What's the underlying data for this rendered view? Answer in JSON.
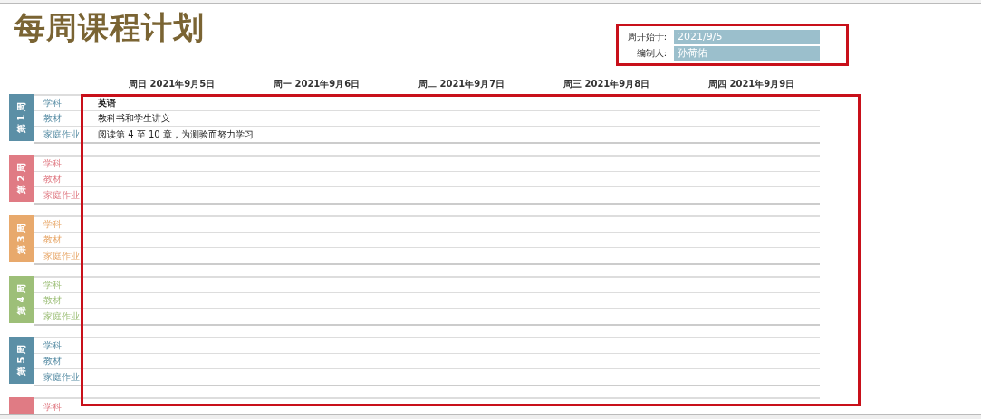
{
  "title": "每周课程计划",
  "info": [
    {
      "label": "周开始于:",
      "value": "2021/9/5"
    },
    {
      "label": "编制人:",
      "value": "孙荷佑"
    }
  ],
  "days": [
    "周日 2021年9月5日",
    "周一 2021年9月6日",
    "周二 2021年9月7日",
    "周三 2021年9月8日",
    "周四 2021年9月9日"
  ],
  "weeks": [
    {
      "label": "第 1 周",
      "color": "#5b8fa6",
      "rows": [
        {
          "field": "学科",
          "value": "英语",
          "bold": true
        },
        {
          "field": "教材",
          "value": "教科书和学生讲义"
        },
        {
          "field": "家庭作业",
          "value": "阅读第 4 至 10 章，为测验而努力学习"
        }
      ]
    },
    {
      "label": "第 2 周",
      "color": "#e07b84",
      "rows": [
        {
          "field": "学科"
        },
        {
          "field": "教材"
        },
        {
          "field": "家庭作业"
        }
      ]
    },
    {
      "label": "第 3 周",
      "color": "#e8a96c",
      "rows": [
        {
          "field": "学科"
        },
        {
          "field": "教材"
        },
        {
          "field": "家庭作业"
        }
      ]
    },
    {
      "label": "第 4 周",
      "color": "#9dbf78",
      "rows": [
        {
          "field": "学科"
        },
        {
          "field": "教材"
        },
        {
          "field": "家庭作业"
        }
      ]
    },
    {
      "label": "第 5 周",
      "color": "#5b8fa6",
      "rows": [
        {
          "field": "学科"
        },
        {
          "field": "教材"
        },
        {
          "field": "家庭作业"
        }
      ]
    },
    {
      "color": "#e07b84",
      "rows": [
        {
          "field": "学科"
        }
      ]
    }
  ]
}
